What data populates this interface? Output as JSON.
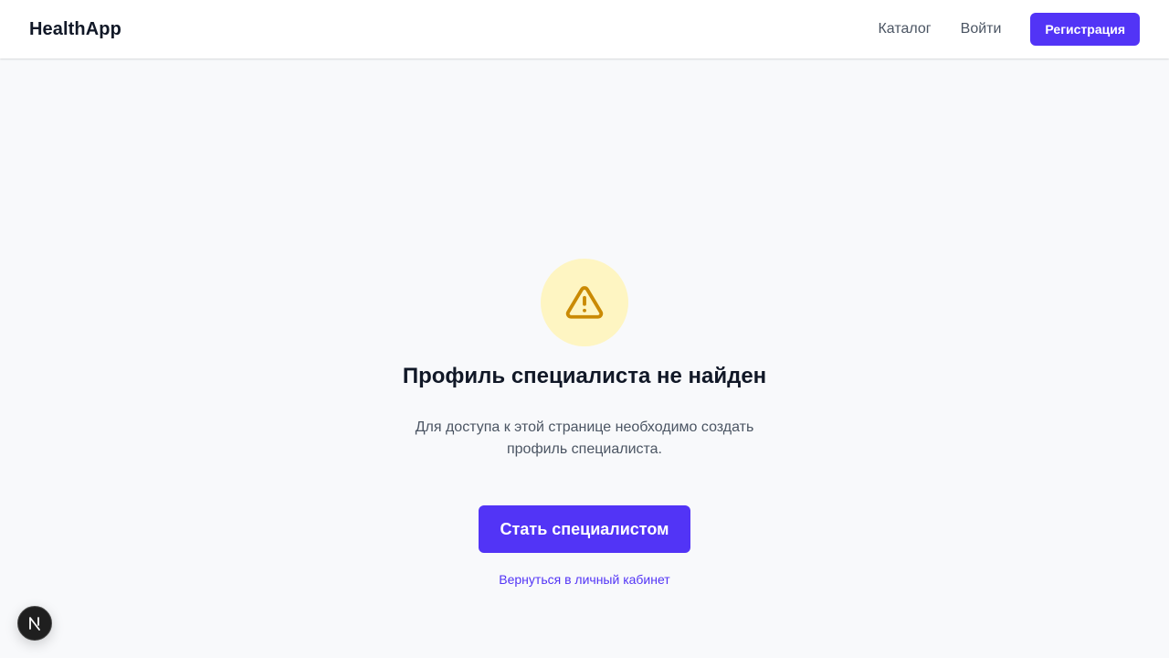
{
  "header": {
    "brand": "HealthApp",
    "nav": {
      "catalog": "Каталог",
      "login": "Войти",
      "register": "Регистрация"
    }
  },
  "main": {
    "icon": "warning-triangle-icon",
    "title": "Профиль специалиста не найден",
    "description": "Для доступа к этой странице необходимо создать профиль специалиста.",
    "primary_button": "Стать специалистом",
    "back_link": "Вернуться в личный кабинет"
  },
  "dev_badge": {
    "icon": "nextjs-icon"
  },
  "colors": {
    "accent": "#5234f6",
    "warning_bg": "#fef5c2",
    "warning_icon": "#ca8a04",
    "page_bg": "#f8f9fb"
  }
}
